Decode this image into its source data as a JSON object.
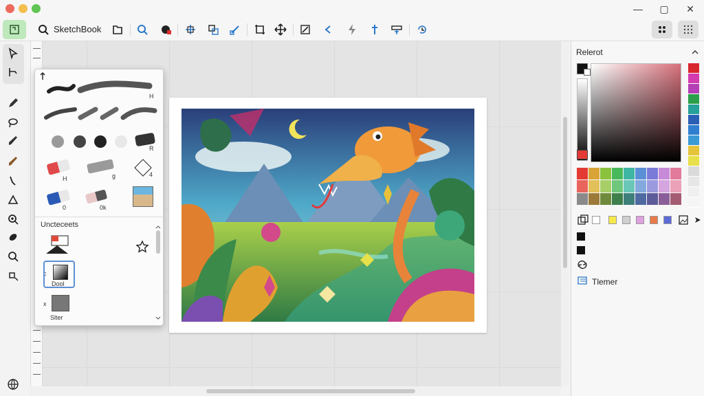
{
  "app": {
    "name": "SketchBook"
  },
  "window_controls": {
    "minimize": "—",
    "maximize": "▢",
    "close": "✕"
  },
  "brush_popup": {
    "section_title": "Uncteceets",
    "labels": {
      "b1": "H",
      "b2": "R",
      "b3": "H",
      "b4": "g",
      "b5": "4",
      "b6": "0",
      "b7": "0k",
      "preset_prefix": "c",
      "preset_name": "Dool",
      "preset_alt": "x",
      "preset2_name": "Slter"
    }
  },
  "right_panel": {
    "title": "Relerot",
    "layer_label": "Tlemer"
  },
  "colors": {
    "accent_green": "#bfe8bc",
    "icon_blue": "#2a78c8"
  },
  "palette": {
    "hue_column": [
      "#d9272e",
      "#d43bb0",
      "#b53fb6",
      "#2aa04a",
      "#26a09a",
      "#2b5fb5",
      "#2f7fd0",
      "#3a9ad6",
      "#e5c43a",
      "#e8e04a",
      "#dadada",
      "#e6e6e6",
      "#f0f0f0",
      "#f5f5f5"
    ],
    "swatches": [
      "#e33b34",
      "#d9a337",
      "#8ac13d",
      "#48b95a",
      "#3fb6a4",
      "#5b8fd6",
      "#7a7ad8",
      "#c78ad8",
      "#e27a9c",
      "#e8645c",
      "#e3c15a",
      "#a8cf67",
      "#6fc77d",
      "#6ac7b8",
      "#84a9df",
      "#9b9ade",
      "#d4a5df",
      "#eba2b8",
      "#8a8a8a",
      "#9c7b3a",
      "#6f8a3c",
      "#3f7f4c",
      "#3f7f7a",
      "#4e6aa0",
      "#5c5a98",
      "#8a5e98",
      "#a45d72"
    ],
    "quick": [
      "#f7e84a",
      "#cfcfcf",
      "#e0a0e0",
      "#e87a4a",
      "#5b6ad6"
    ]
  }
}
